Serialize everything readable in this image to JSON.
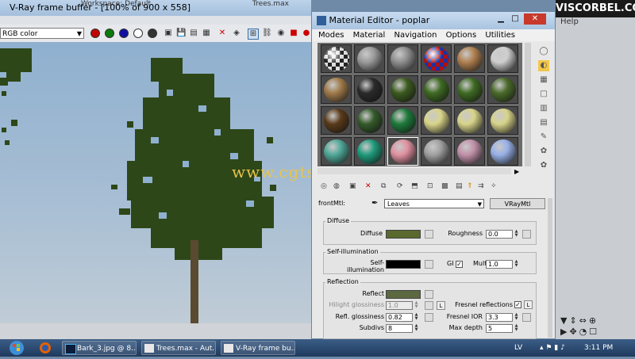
{
  "vfb": {
    "title": "V-Ray frame buffer - [100% of 900 x 558]",
    "channel": "RGB color",
    "toolbar_icons": [
      "red-channel-icon",
      "green-channel-icon",
      "blue-channel-icon",
      "alpha-channel-icon",
      "save-icon",
      "copy-icon",
      "clear-icon",
      "region-icon",
      "link-icon",
      "lens-icon",
      "render-icon",
      "stop-icon"
    ],
    "behind_titles": [
      "Workspace: Default",
      "Trees.max"
    ]
  },
  "watermark": "www.cgtsj.com",
  "material_editor": {
    "title": "Material Editor - poplar",
    "menu": [
      "Modes",
      "Material",
      "Navigation",
      "Options",
      "Utilities"
    ],
    "slots": [
      [
        "checker",
        "#9a9a9a",
        "#8e8e8e",
        "checker-red",
        "#b08050",
        "#cfcfcf"
      ],
      [
        "#a07a4a",
        "#2a2a2a",
        "#3b5a1f",
        "#3e6a22",
        "#3e6a22",
        "#4a6a2a"
      ],
      [
        "#5a3a1a",
        "#345a2a",
        "#1e7a3a",
        "#d8d48a",
        "#d8d48a",
        "#d8d48a"
      ],
      [
        "#4fa898",
        "#1e9a7a",
        "#e090a0",
        "#a0a0a0",
        "#c090a8",
        "#98b0e8"
      ]
    ],
    "front_mtl_label": "frontMtl:",
    "front_mtl_value": "Leaves",
    "front_mtl_type": "VRayMtl",
    "diffuse": {
      "section": "Diffuse",
      "diffuse_label": "Diffuse",
      "diffuse_color": "#5a6a2e",
      "roughness_label": "Roughness",
      "roughness": "0.0"
    },
    "self_illum": {
      "section": "Self-illumination",
      "label": "Self-illumination",
      "color": "#000000",
      "gi_label": "GI",
      "mult_label": "Mult",
      "mult": "1.0"
    },
    "reflection": {
      "section": "Reflection",
      "reflect_label": "Reflect",
      "reflect_color": "#5b6840",
      "hilight_label": "Hilight glossiness",
      "hilight": "1.0",
      "l_btn": "L",
      "fresnel_label": "Fresnel reflections",
      "refl_gloss_label": "Refl. glossiness",
      "refl_gloss": "0.82",
      "fresnel_ior_label": "Fresnel IOR",
      "fresnel_ior": "3.3",
      "subdivs_label": "Subdivs",
      "subdivs": "8",
      "max_depth_label": "Max depth",
      "max_depth": "5"
    }
  },
  "brand": "VISCORBEL.COM",
  "help": "Help",
  "taskbar": {
    "tasks": [
      "Bark_3.jpg @ 8...",
      "Trees.max - Aut...",
      "V-Ray frame bu..."
    ],
    "lang": "LV",
    "time": "3:11 PM"
  }
}
